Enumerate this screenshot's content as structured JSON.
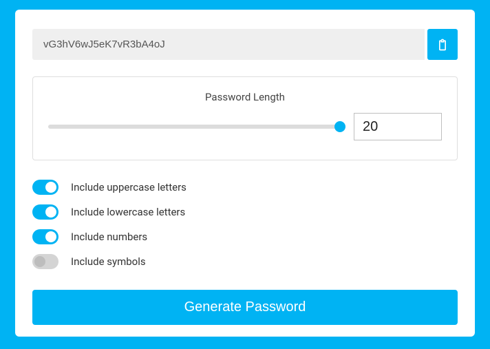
{
  "output": {
    "value": "vG3hV6wJ5eK7vR3bA4oJ"
  },
  "length": {
    "label": "Password Length",
    "value": "20"
  },
  "options": {
    "uppercase": {
      "label": "Include uppercase letters",
      "on": true
    },
    "lowercase": {
      "label": "Include lowercase letters",
      "on": true
    },
    "numbers": {
      "label": "Include numbers",
      "on": true
    },
    "symbols": {
      "label": "Include symbols",
      "on": false
    }
  },
  "generate": {
    "label": "Generate Password"
  }
}
